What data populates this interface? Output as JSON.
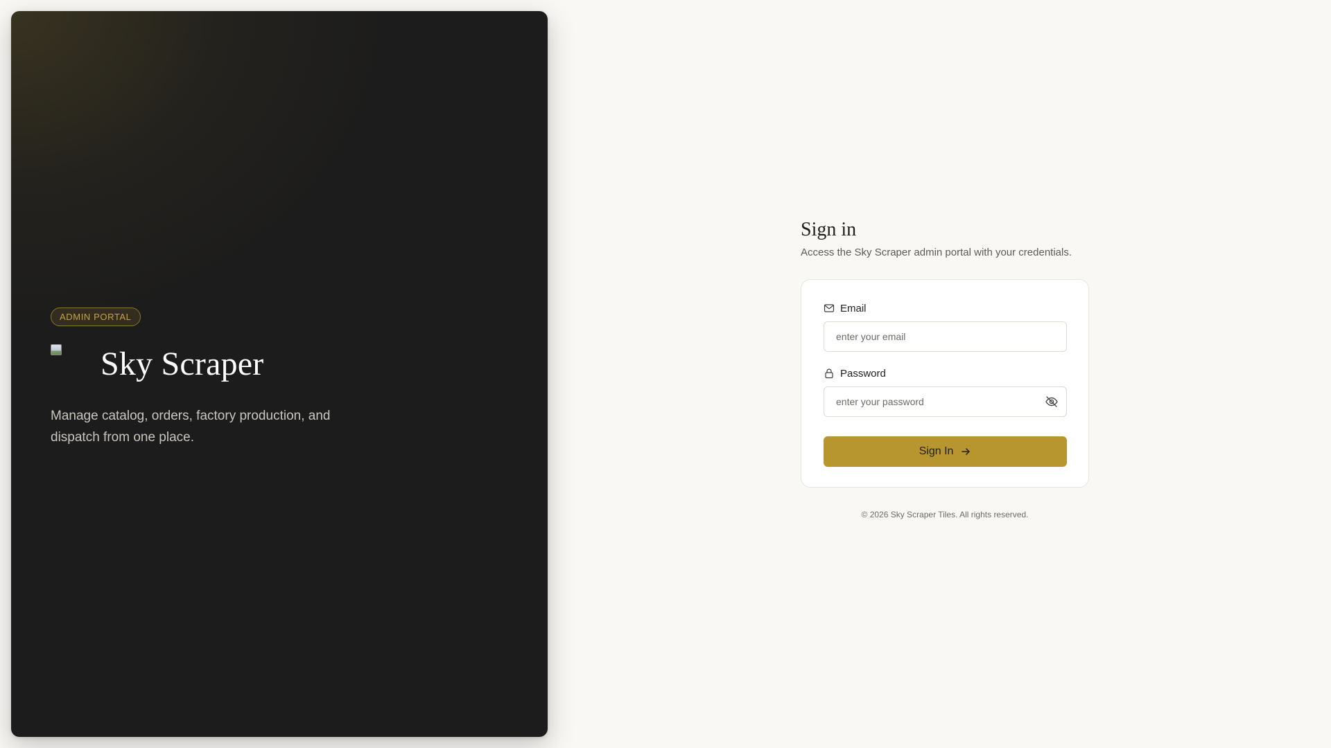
{
  "hero": {
    "badge": "ADMIN PORTAL",
    "title": "Sky Scraper",
    "description": "Manage catalog, orders, factory production, and dispatch from one place.",
    "logo_icon": "broken-image-icon"
  },
  "signin": {
    "title": "Sign in",
    "subtitle": "Access the Sky Scraper admin portal with your credentials.",
    "email": {
      "label": "Email",
      "placeholder": "enter your email",
      "value": "",
      "icon": "mail-icon"
    },
    "password": {
      "label": "Password",
      "placeholder": "enter your password",
      "value": "",
      "icon": "lock-icon",
      "toggle_icon": "eye-off-icon"
    },
    "submit_label": "Sign In",
    "submit_icon": "arrow-right-icon"
  },
  "footer": "© 2026 Sky Scraper Tiles. All rights reserved.",
  "colors": {
    "accent": "#b8962f",
    "hero_bg": "#1c1c1c",
    "page_bg": "#f9f8f5",
    "badge_text": "#c6a347"
  }
}
